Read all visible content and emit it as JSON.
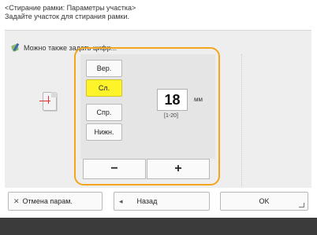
{
  "header": {
    "title": "<Стирание рамки: Параметры участка>",
    "subtitle": "Задайте участок для стирания рамки."
  },
  "info": {
    "icon": "edit-leaf-icon",
    "text": "Можно также задать цифр..."
  },
  "options": [
    {
      "label": "Вер.",
      "selected": false
    },
    {
      "label": "Сл.",
      "selected": true
    },
    {
      "label": "Спр.",
      "selected": false
    },
    {
      "label": "Нижн.",
      "selected": false
    }
  ],
  "value": {
    "current": "18",
    "unit": "мм",
    "range": "[1-20]"
  },
  "steppers": {
    "minus": "−",
    "plus": "+"
  },
  "footer": {
    "reset": "Отмена парам.",
    "reset_icon": "✕",
    "back": "Назад",
    "back_icon": "◂",
    "ok": "OK"
  },
  "colors": {
    "selected": "#fff32a",
    "frame": "#f3a51c"
  }
}
